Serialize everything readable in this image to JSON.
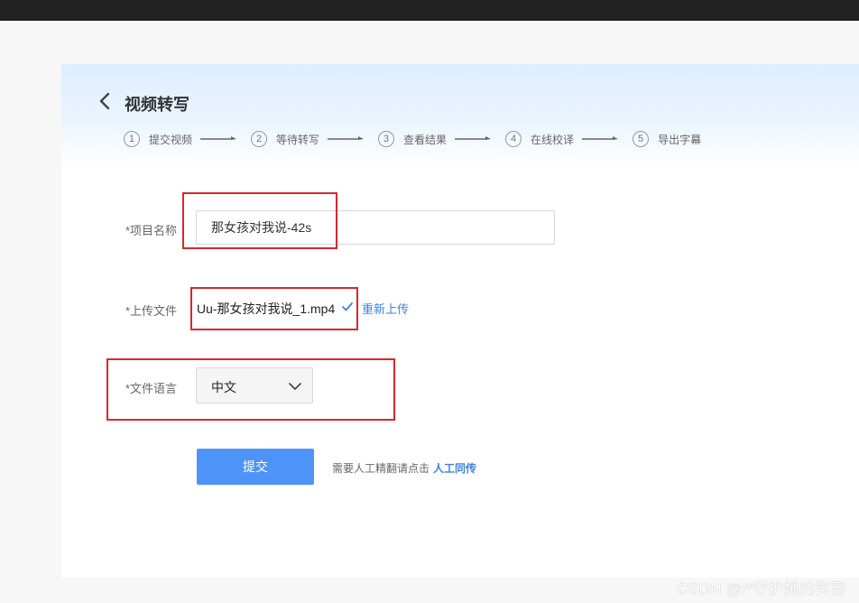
{
  "header": {
    "title": "视频转写"
  },
  "steps": [
    {
      "num": "1",
      "label": "提交视频"
    },
    {
      "num": "2",
      "label": "等待转写"
    },
    {
      "num": "3",
      "label": "查看结果"
    },
    {
      "num": "4",
      "label": "在线校译"
    },
    {
      "num": "5",
      "label": "导出字幕"
    }
  ],
  "form": {
    "project_name_label": "*项目名称",
    "project_name_value": "那女孩对我说-42s",
    "upload_label": "*上传文件",
    "file_name": "Uu-那女孩对我说_1.mp4",
    "reupload_label": "重新上传",
    "language_label": "*文件语言",
    "language_value": "中文",
    "submit_label": "提交",
    "hint_text": "需要人工精翻请点击",
    "hint_link": "人工同传"
  },
  "watermark": "CSDN @/*守护她的笑容",
  "colors": {
    "accent": "#4d93f8",
    "link": "#3f82e6",
    "highlight_box": "#d9272d"
  }
}
